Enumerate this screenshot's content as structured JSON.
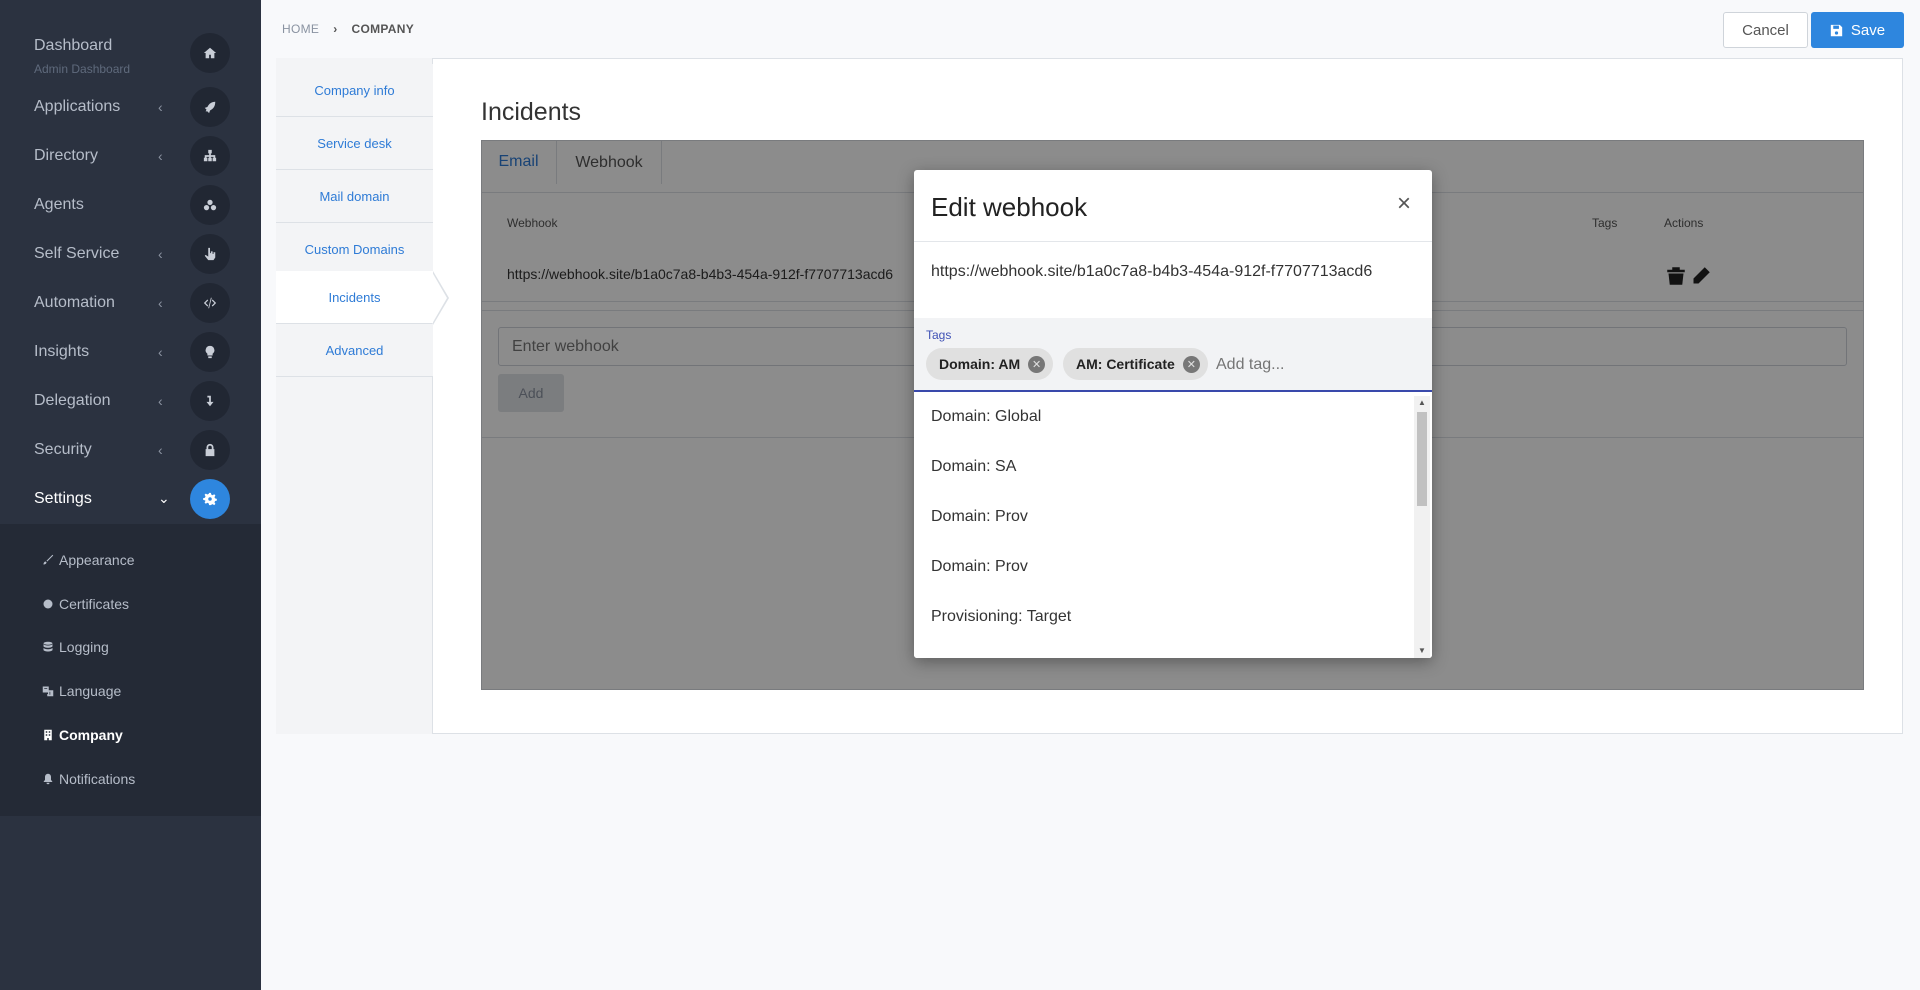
{
  "sidebar": {
    "items": [
      {
        "label": "Dashboard",
        "sub": "Admin Dashboard",
        "icon": "home-icon"
      },
      {
        "label": "Applications",
        "icon": "rocket-icon"
      },
      {
        "label": "Directory",
        "icon": "sitemap-icon"
      },
      {
        "label": "Agents",
        "icon": "agents-icon"
      },
      {
        "label": "Self Service",
        "icon": "hand-pointer-icon"
      },
      {
        "label": "Automation",
        "icon": "code-icon"
      },
      {
        "label": "Insights",
        "icon": "lightbulb-icon"
      },
      {
        "label": "Delegation",
        "icon": "delegation-arrow-icon"
      },
      {
        "label": "Security",
        "icon": "lock-icon"
      },
      {
        "label": "Settings",
        "icon": "gear-icon"
      }
    ],
    "subitems": [
      {
        "label": "Appearance",
        "icon": "paintbrush-icon"
      },
      {
        "label": "Certificates",
        "icon": "certificate-icon"
      },
      {
        "label": "Logging",
        "icon": "database-icon"
      },
      {
        "label": "Language",
        "icon": "language-icon"
      },
      {
        "label": "Company",
        "icon": "building-icon"
      },
      {
        "label": "Notifications",
        "icon": "bell-icon"
      }
    ]
  },
  "breadcrumb": {
    "home": "HOME",
    "current": "COMPANY"
  },
  "toolbar": {
    "cancel_label": "Cancel",
    "save_label": "Save"
  },
  "left_tabs": [
    "Company info",
    "Service desk",
    "Mail domain",
    "Custom Domains",
    "Incidents",
    "Advanced"
  ],
  "section_title": "Incidents",
  "content_tabs": {
    "email": "Email",
    "webhook": "Webhook"
  },
  "table": {
    "headers": {
      "webhook": "Webhook",
      "tags": "Tags",
      "actions": "Actions"
    },
    "row_url": "https://webhook.site/b1a0c7a8-b4b3-454a-912f-f7707713acd6"
  },
  "webhook_input": {
    "placeholder": "Enter webhook"
  },
  "add_label": "Add",
  "modal": {
    "title": "Edit webhook",
    "close": "×",
    "url": "https://webhook.site/b1a0c7a8-b4b3-454a-912f-f7707713acd6",
    "tags_label": "Tags",
    "chips": [
      "Domain: AM",
      "AM: Certificate"
    ],
    "tag_placeholder": "Add tag...",
    "options": [
      "Domain: Global",
      "Domain: SA",
      "Domain: Prov",
      "Domain: Prov",
      "Provisioning: Target"
    ]
  },
  "colors": {
    "sidebar_bg": "#2b3240",
    "accent": "#2e86de",
    "link": "#2e7bd6"
  }
}
